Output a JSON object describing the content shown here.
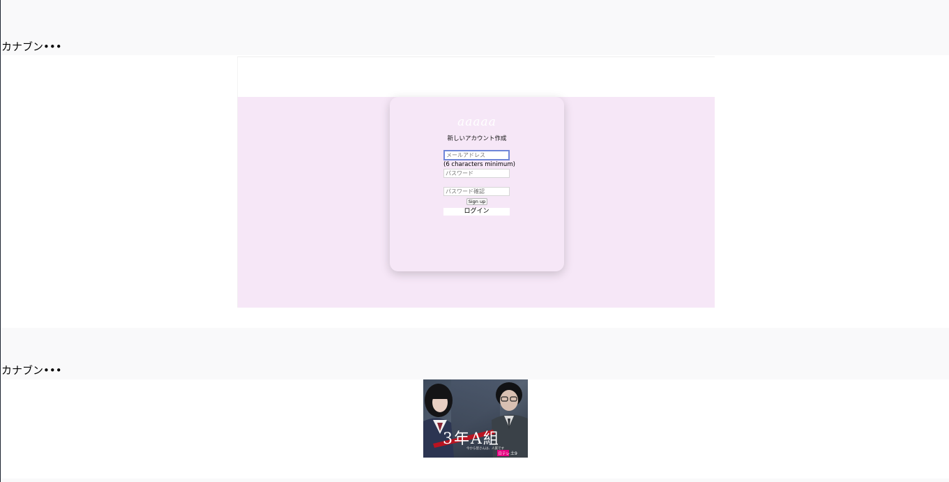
{
  "posts": [
    {
      "title": "カナブン•••",
      "preview": {
        "logo": "aaaaa",
        "heading": "新しいアカウント作成",
        "email_placeholder": "メールアドレス",
        "password_hint": "(6 characters minimum)",
        "password_placeholder": "パスワード",
        "confirm_placeholder": "パスワード確認",
        "signup_label": "Sign up",
        "login_label": "ログイン"
      }
    },
    {
      "title": "カナブン•••",
      "image": {
        "caption": "3年A組",
        "subcaption": "今から皆さんは、人質です",
        "badge": "日テレ",
        "badge_extra": "土9"
      }
    }
  ],
  "colors": {
    "band": "#f9f9fa",
    "preview_bg": "#f6e7f7",
    "focus_border": "#6f86d8"
  }
}
